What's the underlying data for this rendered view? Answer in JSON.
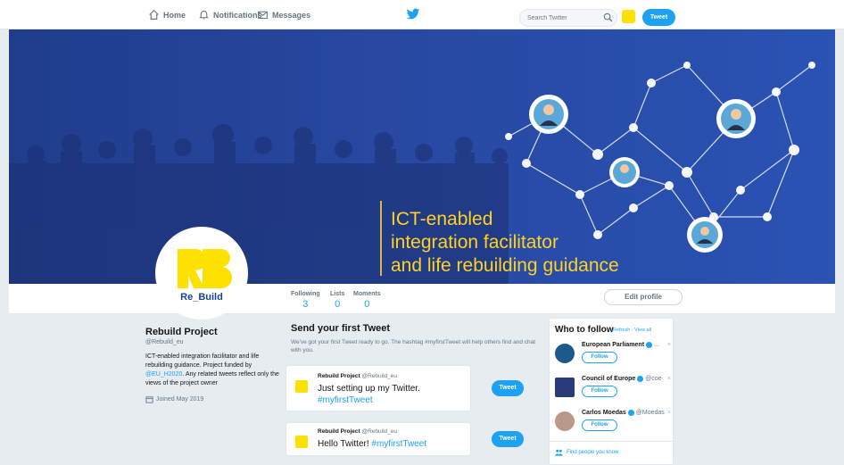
{
  "nav": {
    "home": "Home",
    "notifications": "Notifications",
    "messages": "Messages",
    "search_placeholder": "Search Twitter",
    "tweet": "Tweet"
  },
  "banner": {
    "line1": "ICT-enabled",
    "line2": "integration facilitator",
    "line3": "and life rebuilding guidance"
  },
  "profile_nav": {
    "stats": [
      {
        "label": "Following",
        "value": "3"
      },
      {
        "label": "Lists",
        "value": "0"
      },
      {
        "label": "Moments",
        "value": "0"
      }
    ],
    "edit_profile": "Edit profile"
  },
  "avatar": {
    "label": "Re_Build"
  },
  "profile": {
    "name": "Rebuild Project",
    "handle": "@Rebuild_eu",
    "bio_part1": "ICT-enabled integration facilitator and life rebuilding guidance. Project funded by ",
    "bio_link": "@EU_H2020",
    "bio_part2": ". Any related tweets reflect only the views of the project owner",
    "joined": "Joined May 2019"
  },
  "first_tweet": {
    "title": "Send your first Tweet",
    "desc": "We've got your first Tweet ready to go. The hashtag #myfirstTweet will help others find and chat with you.",
    "cards": [
      {
        "name": "Rebuild Project",
        "handle": "@Rebuild_eu",
        "text": "Just setting up my Twitter.",
        "hashtag": "#myfirstTweet",
        "button": "Tweet"
      },
      {
        "name": "Rebuild Project",
        "handle": "@Rebuild_eu",
        "text": "Hello Twitter!",
        "hashtag": "#myfirstTweet",
        "button": "Tweet"
      }
    ]
  },
  "who_to_follow": {
    "title": "Who to follow",
    "refresh": "Refresh",
    "view_all": "View all",
    "suggestions": [
      {
        "name": "European Parliament",
        "handle": "...",
        "follow": "Follow",
        "close": "×"
      },
      {
        "name": "Council of Europe",
        "handle": "@coe",
        "follow": "Follow",
        "close": "×"
      },
      {
        "name": "Carlos Moedas",
        "handle": "@Moedas",
        "follow": "Follow",
        "close": "×"
      }
    ],
    "find_people": "Find people you know"
  },
  "colors": {
    "accent": "#1da1f2",
    "brand_yellow": "#ffe100",
    "banner_blue": "#2848a1"
  }
}
